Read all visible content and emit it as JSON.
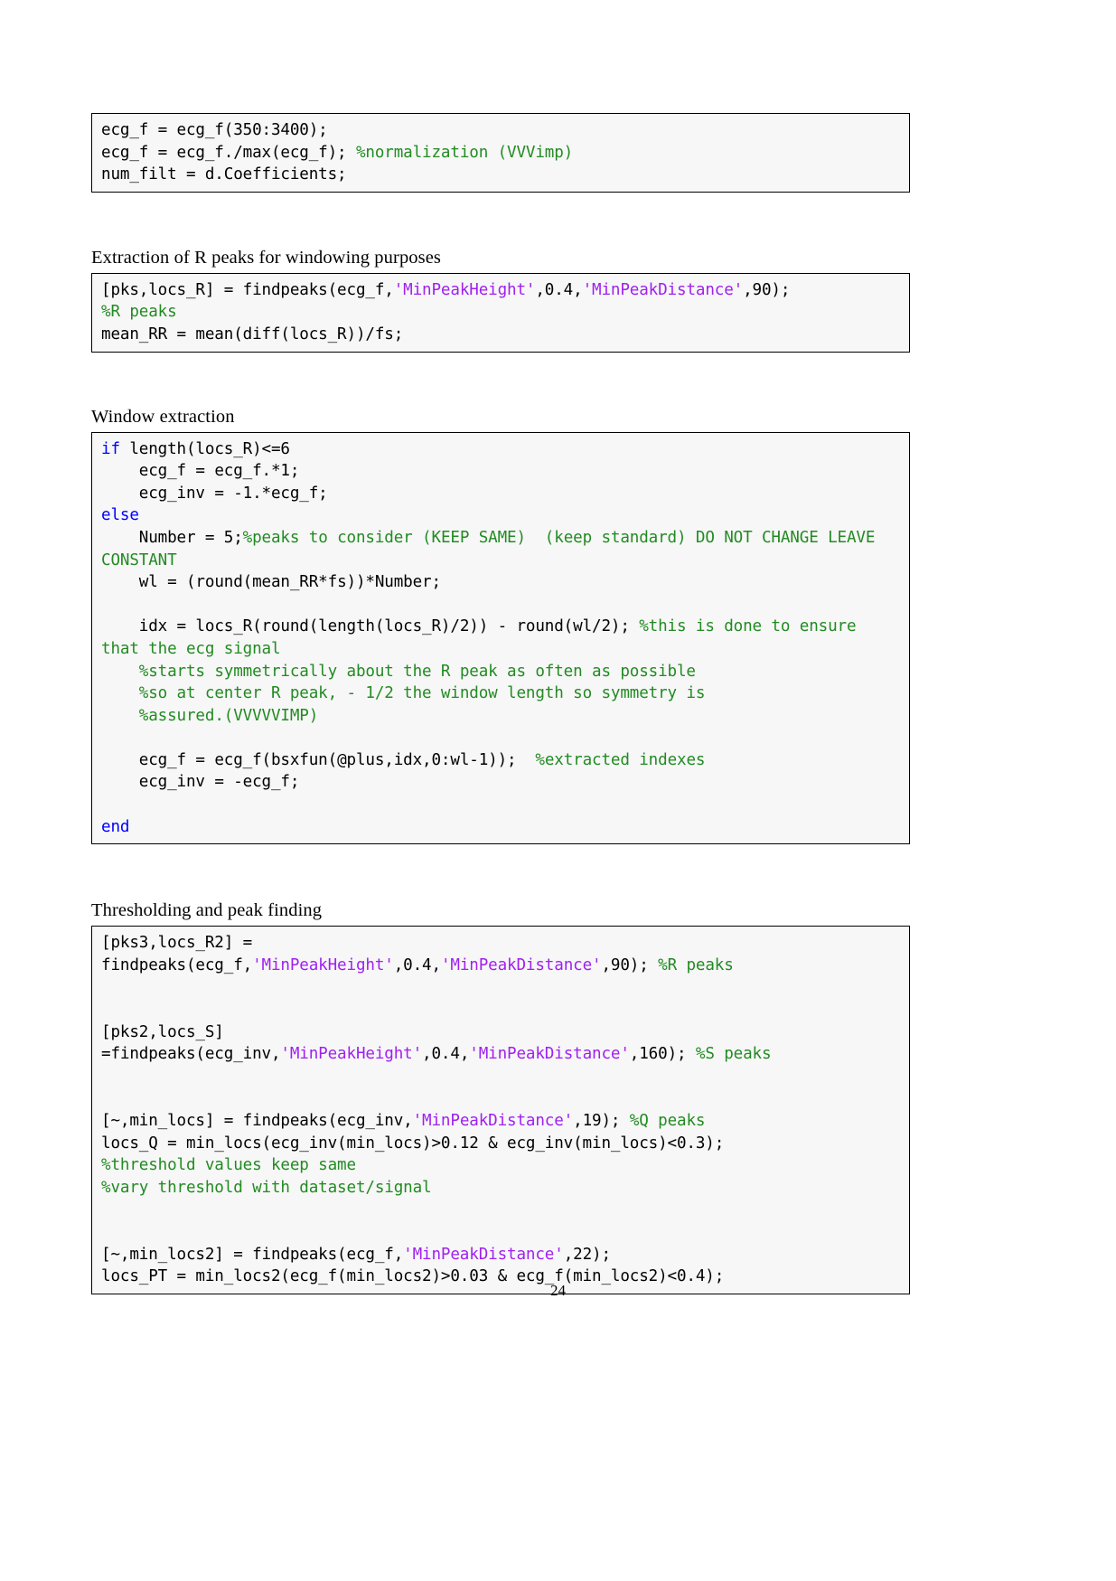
{
  "page": {
    "number": "24"
  },
  "blocks": [
    {
      "kind": "code",
      "name": "code-block-normalization",
      "lines": [
        [
          {
            "t": "ecg_f = ecg_f(350:3400);",
            "c": "plain"
          }
        ],
        [
          {
            "t": "ecg_f = ecg_f./max(ecg_f); ",
            "c": "plain"
          },
          {
            "t": "%normalization (VVVimp)",
            "c": "com"
          }
        ],
        [
          {
            "t": "num_filt = d.Coefficients;",
            "c": "plain"
          }
        ]
      ]
    },
    {
      "kind": "heading",
      "name": "heading-extraction-of-r-peaks",
      "text": "Extraction of R peaks for windowing purposes"
    },
    {
      "kind": "code",
      "name": "code-block-r-peak-extraction",
      "lines": [
        [
          {
            "t": "[pks,locs_R] = findpeaks(ecg_f,",
            "c": "plain"
          },
          {
            "t": "'MinPeakHeight'",
            "c": "str"
          },
          {
            "t": ",0.4,",
            "c": "plain"
          },
          {
            "t": "'MinPeakDistance'",
            "c": "str"
          },
          {
            "t": ",90);",
            "c": "plain"
          }
        ],
        [
          {
            "t": "%R peaks",
            "c": "com"
          }
        ],
        [
          {
            "t": "mean_RR = mean(diff(locs_R))/fs;",
            "c": "plain"
          }
        ]
      ]
    },
    {
      "kind": "heading",
      "name": "heading-window-extraction",
      "text": "Window extraction"
    },
    {
      "kind": "code",
      "name": "code-block-window-extraction",
      "lines": [
        [
          {
            "t": "if",
            "c": "kw"
          },
          {
            "t": " length(locs_R)<=6",
            "c": "plain"
          }
        ],
        [
          {
            "t": "    ecg_f = ecg_f.*1;",
            "c": "plain"
          }
        ],
        [
          {
            "t": "    ecg_inv = -1.*ecg_f;",
            "c": "plain"
          }
        ],
        [
          {
            "t": "else",
            "c": "kw"
          }
        ],
        [
          {
            "t": "    Number = 5;",
            "c": "plain"
          },
          {
            "t": "%peaks to consider (KEEP SAME)  (keep standard) DO NOT CHANGE LEAVE CONSTANT",
            "c": "com"
          }
        ],
        [
          {
            "t": "    wl = (round(mean_RR*fs))*Number;",
            "c": "plain"
          }
        ],
        [
          {
            "t": "",
            "c": "blank"
          }
        ],
        [
          {
            "t": "    idx = locs_R(round(length(locs_R)/2)) - round(wl/2); ",
            "c": "plain"
          },
          {
            "t": "%this is done to ensure that the ecg signal",
            "c": "com"
          }
        ],
        [
          {
            "t": "    ",
            "c": "plain"
          },
          {
            "t": "%starts symmetrically about the R peak as often as possible",
            "c": "com"
          }
        ],
        [
          {
            "t": "    ",
            "c": "plain"
          },
          {
            "t": "%so at center R peak, - 1/2 the window length so symmetry is",
            "c": "com"
          }
        ],
        [
          {
            "t": "    ",
            "c": "plain"
          },
          {
            "t": "%assured.(VVVVVIMP)",
            "c": "com"
          }
        ],
        [
          {
            "t": "",
            "c": "blank"
          }
        ],
        [
          {
            "t": "    ecg_f = ecg_f(bsxfun(@plus,idx,0:wl-1));  ",
            "c": "plain"
          },
          {
            "t": "%extracted indexes",
            "c": "com"
          }
        ],
        [
          {
            "t": "    ecg_inv = -ecg_f;",
            "c": "plain"
          }
        ],
        [
          {
            "t": "",
            "c": "blank"
          }
        ],
        [
          {
            "t": "end",
            "c": "kw"
          }
        ]
      ]
    },
    {
      "kind": "heading",
      "name": "heading-thresholding-and-peak-finding",
      "text": "Thresholding and peak finding"
    },
    {
      "kind": "code",
      "name": "code-block-thresholding-peak-finding",
      "lines": [
        [
          {
            "t": "[pks3,locs_R2] =",
            "c": "plain"
          }
        ],
        [
          {
            "t": "findpeaks(ecg_f,",
            "c": "plain"
          },
          {
            "t": "'MinPeakHeight'",
            "c": "str"
          },
          {
            "t": ",0.4,",
            "c": "plain"
          },
          {
            "t": "'MinPeakDistance'",
            "c": "str"
          },
          {
            "t": ",90); ",
            "c": "plain"
          },
          {
            "t": "%R peaks",
            "c": "com"
          }
        ],
        [
          {
            "t": "",
            "c": "blank"
          }
        ],
        [
          {
            "t": "",
            "c": "blank"
          }
        ],
        [
          {
            "t": "[pks2,locs_S]",
            "c": "plain"
          }
        ],
        [
          {
            "t": "=findpeaks(ecg_inv,",
            "c": "plain"
          },
          {
            "t": "'MinPeakHeight'",
            "c": "str"
          },
          {
            "t": ",0.4,",
            "c": "plain"
          },
          {
            "t": "'MinPeakDistance'",
            "c": "str"
          },
          {
            "t": ",160); ",
            "c": "plain"
          },
          {
            "t": "%S peaks",
            "c": "com"
          }
        ],
        [
          {
            "t": "",
            "c": "blank"
          }
        ],
        [
          {
            "t": "",
            "c": "blank"
          }
        ],
        [
          {
            "t": "[~,min_locs] = findpeaks(ecg_inv,",
            "c": "plain"
          },
          {
            "t": "'MinPeakDistance'",
            "c": "str"
          },
          {
            "t": ",19); ",
            "c": "plain"
          },
          {
            "t": "%Q peaks",
            "c": "com"
          }
        ],
        [
          {
            "t": "locs_Q = min_locs(ecg_inv(min_locs)>0.12 & ecg_inv(min_locs)<0.3);",
            "c": "plain"
          }
        ],
        [
          {
            "t": "%threshold values keep same",
            "c": "com"
          }
        ],
        [
          {
            "t": "%vary threshold with dataset/signal",
            "c": "com"
          }
        ],
        [
          {
            "t": "",
            "c": "blank"
          }
        ],
        [
          {
            "t": "",
            "c": "blank"
          }
        ],
        [
          {
            "t": "[~,min_locs2] = findpeaks(ecg_f,",
            "c": "plain"
          },
          {
            "t": "'MinPeakDistance'",
            "c": "str"
          },
          {
            "t": ",22);",
            "c": "plain"
          }
        ],
        [
          {
            "t": "locs_PT = min_locs2(ecg_f(min_locs2)>0.03 & ecg_f(min_locs2)<0.4);",
            "c": "plain"
          }
        ]
      ]
    }
  ],
  "colors": {
    "keyword": "#0000ff",
    "string": "#a020f0",
    "comment": "#228b22",
    "code_background": "#f7f7f7",
    "border": "#000000",
    "text": "#000000"
  }
}
